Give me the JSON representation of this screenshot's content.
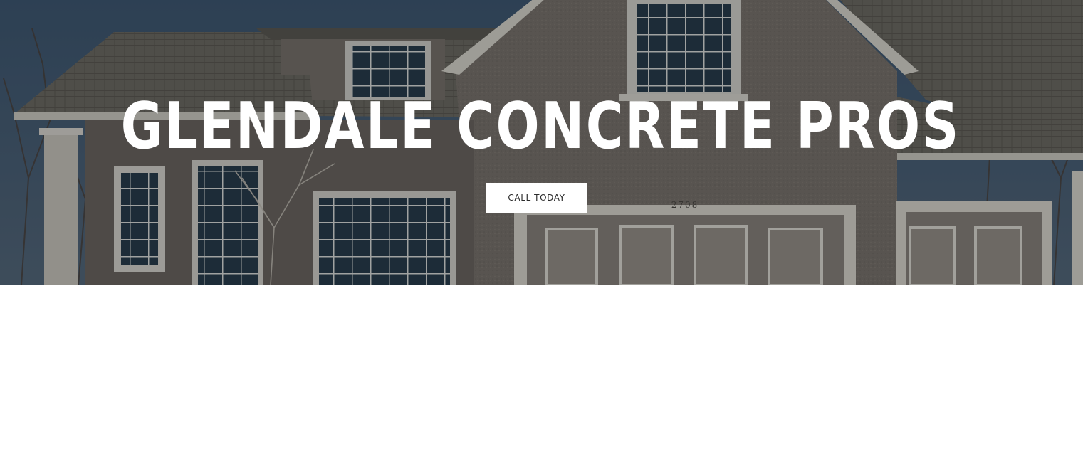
{
  "hero": {
    "title": "GLENDALE CONCRETE PROS",
    "house_number": "2708",
    "cta_label": "CALL TODAY"
  },
  "colors": {
    "title_text": "#ffffff",
    "button_bg": "#ffffff",
    "button_text": "#2b2b2b",
    "page_bg": "#ffffff"
  }
}
